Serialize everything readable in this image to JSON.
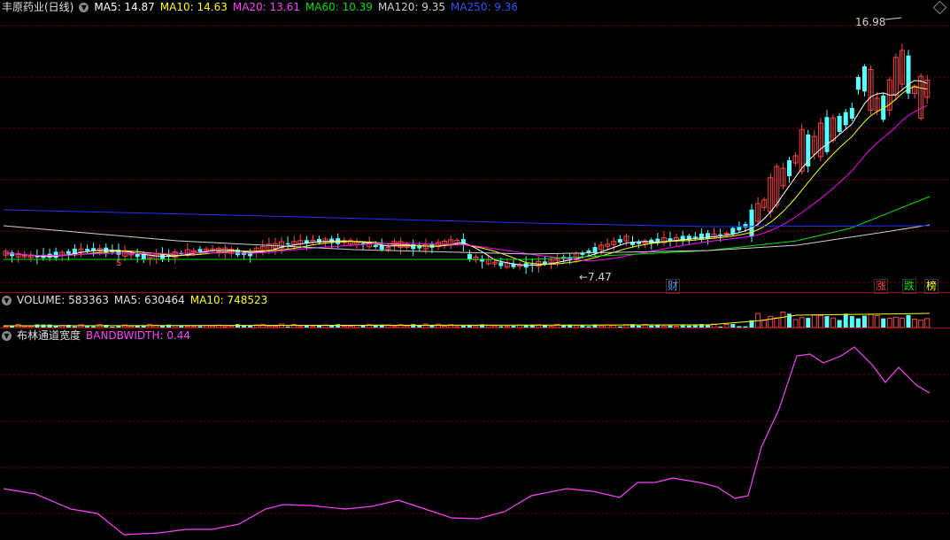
{
  "main": {
    "stock_name": "丰原药业(日线)",
    "ma5": "MA5: 14.87",
    "ma10": "MA10: 14.63",
    "ma20": "MA20: 13.61",
    "ma60": "MA60: 10.39",
    "ma120": "MA120: 9.35",
    "ma250": "MA250: 9.36",
    "high_label": "16.98",
    "low_label": "7.47",
    "marker_s": "s",
    "badge_cai": "财",
    "badge_zhang": "涨",
    "badge_die": "跌",
    "badge_bang": "榜"
  },
  "volume": {
    "label": "VOLUME: 583363",
    "ma5": "MA5: 630464",
    "ma10": "MA10: 748523"
  },
  "indicator": {
    "name": "布林通道宽度",
    "value": "BANDBWIDTH: 0.44"
  },
  "colors": {
    "up": "#ff4040",
    "down": "#54ffff",
    "ma5": "#ffffff",
    "ma10": "#ffff00",
    "ma20": "#ff00ff",
    "ma60": "#00e000",
    "ma120": "#d0d0d0",
    "ma250": "#2030ff",
    "grid": "#8b0000"
  }
}
